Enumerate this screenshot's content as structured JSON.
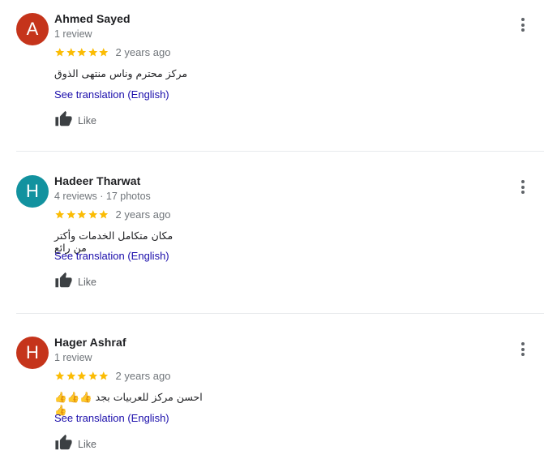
{
  "reviews": [
    {
      "avatar_letter": "A",
      "avatar_color": "#c5341b",
      "name": "Ahmed Sayed",
      "meta": "1 review",
      "rating": 5,
      "date": "2 years ago",
      "text": "مركز محترم وناس منتهى الذوق",
      "translate_label": "See translation (English)",
      "like_label": "Like"
    },
    {
      "avatar_letter": "H",
      "avatar_color": "#12929f",
      "name": "Hadeer Tharwat",
      "meta": "4 reviews · 17 photos",
      "rating": 5,
      "date": "2 years ago",
      "text": "مكان متكامل الخدمات وأكتر من رائع",
      "translate_label": "See translation (English)",
      "like_label": "Like"
    },
    {
      "avatar_letter": "H",
      "avatar_color": "#c5341b",
      "name": "Hager Ashraf",
      "meta": "1 review",
      "rating": 5,
      "date": "2 years ago",
      "text": "احسن مركز للعربيات بجد 👍👍👍👍",
      "translate_label": "See translation (English)",
      "like_label": "Like"
    }
  ],
  "colors": {
    "star": "#fbbc04",
    "link": "#1a0dab",
    "divider": "#e8eaed"
  }
}
